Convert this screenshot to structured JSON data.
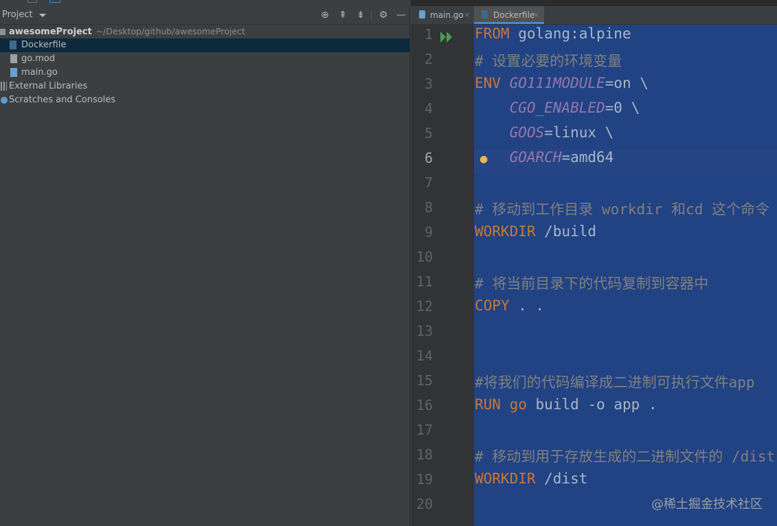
{
  "project_panel": {
    "title": "Project",
    "toolbar_icons": [
      "locate-icon",
      "expand-all-icon",
      "collapse-all-icon",
      "gear-icon",
      "minimize-icon"
    ],
    "tree": [
      {
        "label": "awesomeProject",
        "path": "~/Desktop/github/awesomeProject",
        "icon": "folder-icon"
      },
      {
        "label": "Dockerfile",
        "icon": "docker-file-icon",
        "selected": true
      },
      {
        "label": "go.mod",
        "icon": "file-icon"
      },
      {
        "label": "main.go",
        "icon": "go-file-icon"
      },
      {
        "label": "External Libraries",
        "icon": "libraries-icon"
      },
      {
        "label": "Scratches and Consoles",
        "icon": "scratches-icon"
      }
    ]
  },
  "editor": {
    "tabs": [
      {
        "label": "main.go",
        "close": "×",
        "icon": "go-file-icon"
      },
      {
        "label": "Dockerfile",
        "close": "×",
        "icon": "docker-file-icon",
        "active": true
      }
    ],
    "current_line": 6,
    "lines": [
      {
        "n": "1",
        "tokens": [
          [
            "kw",
            "FROM"
          ],
          [
            "t",
            " golang:alpine"
          ]
        ]
      },
      {
        "n": "2",
        "tokens": [
          [
            "cm",
            "# 设置必要的环境变量"
          ]
        ]
      },
      {
        "n": "3",
        "tokens": [
          [
            "kw",
            "ENV"
          ],
          [
            "t",
            " "
          ],
          [
            "var",
            "GO111MODULE"
          ],
          [
            "t",
            "=on \\"
          ]
        ]
      },
      {
        "n": "4",
        "tokens": [
          [
            "t",
            "    "
          ],
          [
            "var",
            "CGO_ENABLED"
          ],
          [
            "t",
            "=0 \\"
          ]
        ]
      },
      {
        "n": "5",
        "tokens": [
          [
            "t",
            "    "
          ],
          [
            "var",
            "GOOS"
          ],
          [
            "t",
            "=linux \\"
          ]
        ]
      },
      {
        "n": "6",
        "tokens": [
          [
            "t",
            "    "
          ],
          [
            "var",
            "GOARCH"
          ],
          [
            "t",
            "=amd64"
          ]
        ]
      },
      {
        "n": "7",
        "tokens": []
      },
      {
        "n": "8",
        "tokens": [
          [
            "cm",
            "# 移动到工作目录 workdir 和cd 这个命令"
          ]
        ]
      },
      {
        "n": "9",
        "tokens": [
          [
            "kw",
            "WORKDIR"
          ],
          [
            "t",
            " /build"
          ]
        ]
      },
      {
        "n": "10",
        "tokens": []
      },
      {
        "n": "11",
        "tokens": [
          [
            "cm",
            "# 将当前目录下的代码复制到容器中"
          ]
        ]
      },
      {
        "n": "12",
        "tokens": [
          [
            "kw",
            "COPY"
          ],
          [
            "t",
            " . ."
          ]
        ]
      },
      {
        "n": "13",
        "tokens": []
      },
      {
        "n": "14",
        "tokens": []
      },
      {
        "n": "15",
        "tokens": [
          [
            "cm",
            "#将我们的代码编译成二进制可执行文件app"
          ]
        ]
      },
      {
        "n": "16",
        "tokens": [
          [
            "kw",
            "RUN"
          ],
          [
            "t",
            " "
          ],
          [
            "kw",
            "go"
          ],
          [
            "t",
            " build -o app ."
          ]
        ]
      },
      {
        "n": "17",
        "tokens": []
      },
      {
        "n": "18",
        "tokens": [
          [
            "cm",
            "# 移动到用于存放生成的二进制文件的 /dist"
          ]
        ]
      },
      {
        "n": "19",
        "tokens": [
          [
            "kw",
            "WORKDIR"
          ],
          [
            "t",
            " /dist"
          ]
        ]
      },
      {
        "n": "20",
        "tokens": []
      }
    ]
  },
  "watermark": "@稀土掘金技术社区",
  "colors": {
    "panel_bg": "#3c3f41",
    "editor_bg": "#2b2b2b",
    "selection": "#214283",
    "keyword": "#cc7832",
    "comment": "#808080",
    "env_var": "#9876aa",
    "text": "#a9b7c6"
  }
}
